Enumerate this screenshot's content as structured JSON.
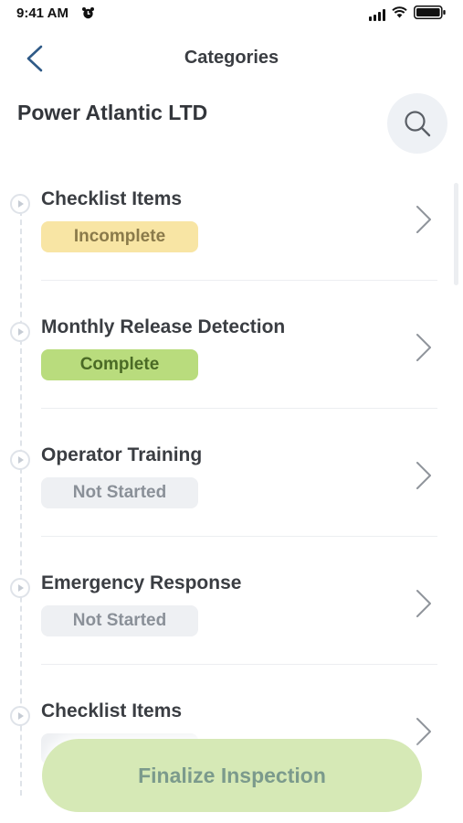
{
  "status_bar": {
    "time": "9:41 AM"
  },
  "nav": {
    "title": "Categories"
  },
  "company": {
    "name": "Power Atlantic LTD"
  },
  "categories": [
    {
      "title": "Checklist Items",
      "status": "Incomplete"
    },
    {
      "title": "Monthly Release Detection",
      "status": "Complete"
    },
    {
      "title": "Operator Training",
      "status": "Not Started"
    },
    {
      "title": "Emergency Response",
      "status": "Not Started"
    },
    {
      "title": "Checklist Items",
      "status": ""
    }
  ],
  "actions": {
    "finalize_label": "Finalize Inspection"
  },
  "colors": {
    "incomplete": "#f8e5a4",
    "complete": "#b9dc7d",
    "not_started": "#eef0f3",
    "finalize_button": "#d6e9b6",
    "back_chevron": "#2f5a87"
  }
}
